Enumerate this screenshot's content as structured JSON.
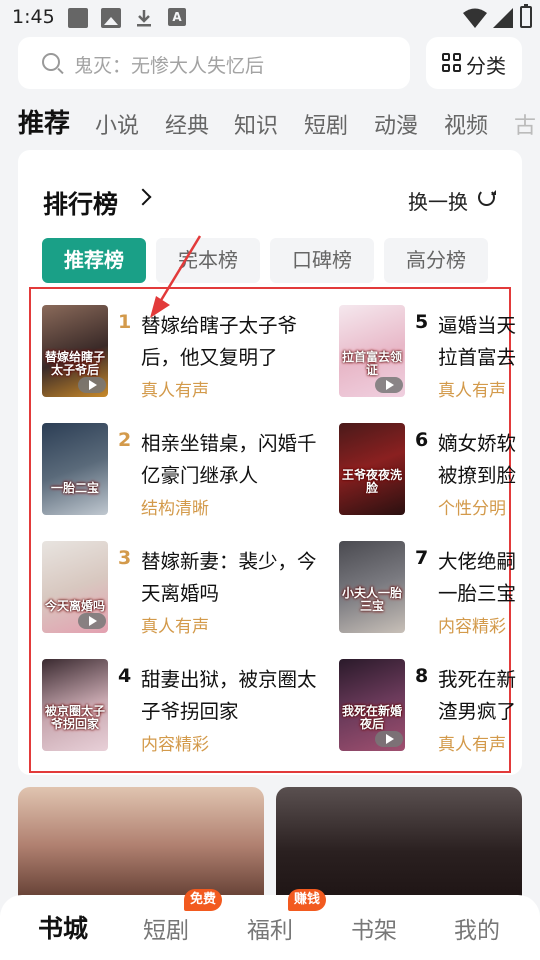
{
  "status_bar": {
    "time": "1:45",
    "a_icon_text": "A"
  },
  "search": {
    "placeholder": "鬼灭：无惨大人失忆后",
    "category_label": "分类"
  },
  "tabs": [
    {
      "label": "推荐",
      "active": true
    },
    {
      "label": "小说"
    },
    {
      "label": "经典"
    },
    {
      "label": "知识"
    },
    {
      "label": "短剧"
    },
    {
      "label": "动漫"
    },
    {
      "label": "视频"
    },
    {
      "label": "古"
    }
  ],
  "ranking": {
    "title": "排行榜",
    "swap_label": "换一换",
    "chips": [
      {
        "label": "推荐榜",
        "active": true
      },
      {
        "label": "完本榜"
      },
      {
        "label": "口碑榜"
      },
      {
        "label": "高分榜"
      }
    ],
    "items": [
      {
        "rank": "1",
        "title": "替嫁给瞎子太子爷后，他又复明了",
        "tag": "真人有声",
        "cover_text": "替嫁给瞎子太子爷后"
      },
      {
        "rank": "2",
        "title": "相亲坐错桌，闪婚千亿豪门继承人",
        "tag": "结构清晰",
        "cover_text": "一胎二宝"
      },
      {
        "rank": "3",
        "title": "替嫁新妻：裴少，今天离婚吗",
        "tag": "真人有声",
        "cover_text": "今天离婚吗"
      },
      {
        "rank": "4",
        "title": "甜妻出狱，被京圈太子爷拐回家",
        "tag": "内容精彩",
        "cover_text": "被京圈太子爷拐回家"
      },
      {
        "rank": "5",
        "title_line1": "逼婚当天",
        "title_line2": "拉首富去",
        "tag": "真人有声",
        "cover_text": "拉首富去领证"
      },
      {
        "rank": "6",
        "title_line1": "嫡女娇软",
        "title_line2": "被撩到脸",
        "tag": "个性分明",
        "cover_text": "王爷夜夜洗脸"
      },
      {
        "rank": "7",
        "title_line1": "大佬绝嗣",
        "title_line2": "一胎三宝",
        "tag": "内容精彩",
        "cover_text": "小夫人一胎三宝"
      },
      {
        "rank": "8",
        "title_line1": "我死在新",
        "title_line2": "渣男疯了",
        "tag": "真人有声",
        "cover_text": "我死在新婚夜后"
      }
    ]
  },
  "bottom_nav": [
    {
      "label": "书城",
      "active": true
    },
    {
      "label": "短剧",
      "badge": "免费"
    },
    {
      "label": "福利",
      "badge": "赚钱"
    },
    {
      "label": "书架"
    },
    {
      "label": "我的"
    }
  ],
  "colors": {
    "accent": "#1aa087",
    "rank_gold": "#d39a4b",
    "highlight_red": "#e23a3a",
    "badge": "#f25a1f"
  }
}
